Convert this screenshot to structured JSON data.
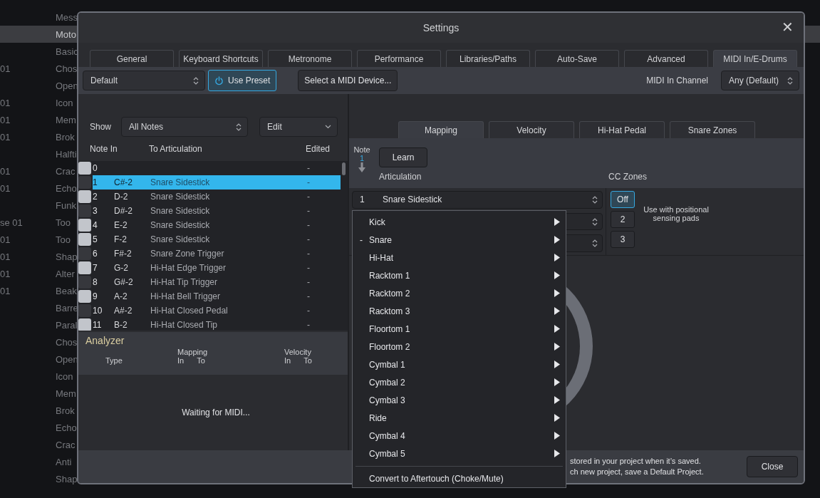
{
  "background_list": {
    "rows": [
      {
        "prefix": "",
        "name": "Mess",
        "selected": false
      },
      {
        "prefix": "",
        "name": "Moto",
        "selected": true
      },
      {
        "prefix": "",
        "name": "Basic",
        "selected": false
      },
      {
        "prefix": "01",
        "name": "Chos",
        "selected": false
      },
      {
        "prefix": "",
        "name": "Open",
        "selected": false
      },
      {
        "prefix": "01",
        "name": "Icon",
        "selected": false
      },
      {
        "prefix": "01",
        "name": "Mem",
        "selected": false
      },
      {
        "prefix": "01",
        "name": "Brok",
        "selected": false
      },
      {
        "prefix": "",
        "name": "Halfti",
        "selected": false
      },
      {
        "prefix": "01",
        "name": "Crac",
        "selected": false
      },
      {
        "prefix": "01",
        "name": "Echo",
        "selected": false
      },
      {
        "prefix": "",
        "name": "Funk",
        "selected": false
      },
      {
        "prefix": "se 01",
        "name": "Too",
        "selected": false
      },
      {
        "prefix": "01",
        "name": "Too",
        "selected": false
      },
      {
        "prefix": "01",
        "name": "Shap",
        "selected": false
      },
      {
        "prefix": "01",
        "name": "Alter",
        "selected": false
      },
      {
        "prefix": "01",
        "name": "Beak",
        "selected": false
      },
      {
        "prefix": "",
        "name": "Barre",
        "selected": false
      },
      {
        "prefix": "",
        "name": "Paral",
        "selected": false
      },
      {
        "prefix": "",
        "name": "Chos",
        "selected": false
      },
      {
        "prefix": "",
        "name": "Open",
        "selected": false
      },
      {
        "prefix": "",
        "name": "Icon",
        "selected": false
      },
      {
        "prefix": "",
        "name": "Mem",
        "selected": false
      },
      {
        "prefix": "",
        "name": "Brok",
        "selected": false
      },
      {
        "prefix": "",
        "name": "Echo",
        "selected": false
      },
      {
        "prefix": "",
        "name": "Crac",
        "selected": false
      },
      {
        "prefix": "",
        "name": "Anti",
        "selected": false
      },
      {
        "prefix": "",
        "name": "Shap",
        "selected": false
      }
    ]
  },
  "window": {
    "title": "Settings",
    "close": "✕"
  },
  "tabs": [
    {
      "label": "General",
      "selected": false
    },
    {
      "label": "Keyboard Shortcuts",
      "selected": false
    },
    {
      "label": "Metronome",
      "selected": false
    },
    {
      "label": "Performance",
      "selected": false
    },
    {
      "label": "Libraries/Paths",
      "selected": false
    },
    {
      "label": "Auto-Save",
      "selected": false
    },
    {
      "label": "Advanced",
      "selected": false
    },
    {
      "label": "MIDI In/E-Drums",
      "selected": true
    }
  ],
  "toolbar": {
    "preset": "Default",
    "use_preset": {
      "label": "Use Preset",
      "on": true
    },
    "device_button": "Select a MIDI Device...",
    "channel_label": "MIDI In Channel",
    "channel": "Any (Default)"
  },
  "note_list": {
    "show_label": "Show",
    "show": "All Notes",
    "edit": "Edit",
    "columns": [
      "Note In",
      "To Articulation",
      "Edited"
    ],
    "rows": [
      {
        "number": "0",
        "note": "",
        "articulation": "",
        "edited": "-",
        "kind": "white",
        "selected": false
      },
      {
        "number": "1",
        "note": "C#-2",
        "articulation": "Snare Sidestick",
        "edited": "-",
        "kind": "black",
        "selected": true
      },
      {
        "number": "2",
        "note": "D-2",
        "articulation": "Snare Sidestick",
        "edited": "-",
        "kind": "white",
        "selected": false
      },
      {
        "number": "3",
        "note": "D#-2",
        "articulation": "Snare Sidestick",
        "edited": "-",
        "kind": "black",
        "selected": false
      },
      {
        "number": "4",
        "note": "E-2",
        "articulation": "Snare Sidestick",
        "edited": "-",
        "kind": "white",
        "selected": false
      },
      {
        "number": "5",
        "note": "F-2",
        "articulation": "Snare Sidestick",
        "edited": "-",
        "kind": "white",
        "selected": false
      },
      {
        "number": "6",
        "note": "F#-2",
        "articulation": "Snare Zone Trigger",
        "edited": "-",
        "kind": "black",
        "selected": false
      },
      {
        "number": "7",
        "note": "G-2",
        "articulation": "Hi-Hat Edge Trigger",
        "edited": "-",
        "kind": "white",
        "selected": false
      },
      {
        "number": "8",
        "note": "G#-2",
        "articulation": "Hi-Hat Tip Trigger",
        "edited": "-",
        "kind": "black",
        "selected": false
      },
      {
        "number": "9",
        "note": "A-2",
        "articulation": "Hi-Hat Bell Trigger",
        "edited": "-",
        "kind": "white",
        "selected": false
      },
      {
        "number": "10",
        "note": "A#-2",
        "articulation": "Hi-Hat Closed Pedal",
        "edited": "-",
        "kind": "black",
        "selected": false
      },
      {
        "number": "11",
        "note": "B-2",
        "articulation": "Hi-Hat Closed Tip",
        "edited": "-",
        "kind": "white",
        "selected": false
      }
    ]
  },
  "analyzer": {
    "title": "Analyzer",
    "type": "Type",
    "mapping": "Mapping",
    "velocity": "Velocity",
    "mapping_in": "In",
    "mapping_to": "To",
    "velocity_in": "In",
    "velocity_to": "To",
    "status": "Waiting for MIDI..."
  },
  "sub_tabs": [
    {
      "label": "Mapping",
      "selected": true
    },
    {
      "label": "Velocity",
      "selected": false
    },
    {
      "label": "Hi-Hat Pedal",
      "selected": false
    },
    {
      "label": "Snare Zones",
      "selected": false
    }
  ],
  "mapping": {
    "note_label": "Note",
    "note": "1",
    "learn": "Learn",
    "articulation_label": "Articulation",
    "cc_label": "CC Zones",
    "articulation_number": "1",
    "articulation": "Snare Sidestick",
    "cc_zones": [
      {
        "label": "Off",
        "selected": true
      },
      {
        "label": "2",
        "selected": false
      },
      {
        "label": "3",
        "selected": false
      }
    ],
    "cc_hint": "Use with positional sensing pads"
  },
  "footer": {
    "lines": [
      "stored in your project when it’s saved.",
      "ch new project, save a Default Project."
    ],
    "close": "Close"
  },
  "menu": {
    "items": [
      {
        "label": "Kick"
      },
      {
        "label": "Snare",
        "marker": "-"
      },
      {
        "label": "Hi-Hat"
      },
      {
        "label": "Racktom 1"
      },
      {
        "label": "Racktom 2"
      },
      {
        "label": "Racktom 3"
      },
      {
        "label": "Floortom 1"
      },
      {
        "label": "Floortom 2"
      },
      {
        "label": "Cymbal 1"
      },
      {
        "label": "Cymbal 2"
      },
      {
        "label": "Cymbal 3"
      },
      {
        "label": "Ride"
      },
      {
        "label": "Cymbal 4"
      },
      {
        "label": "Cymbal 5"
      }
    ],
    "action": "Convert to Aftertouch (Choke/Mute)"
  }
}
